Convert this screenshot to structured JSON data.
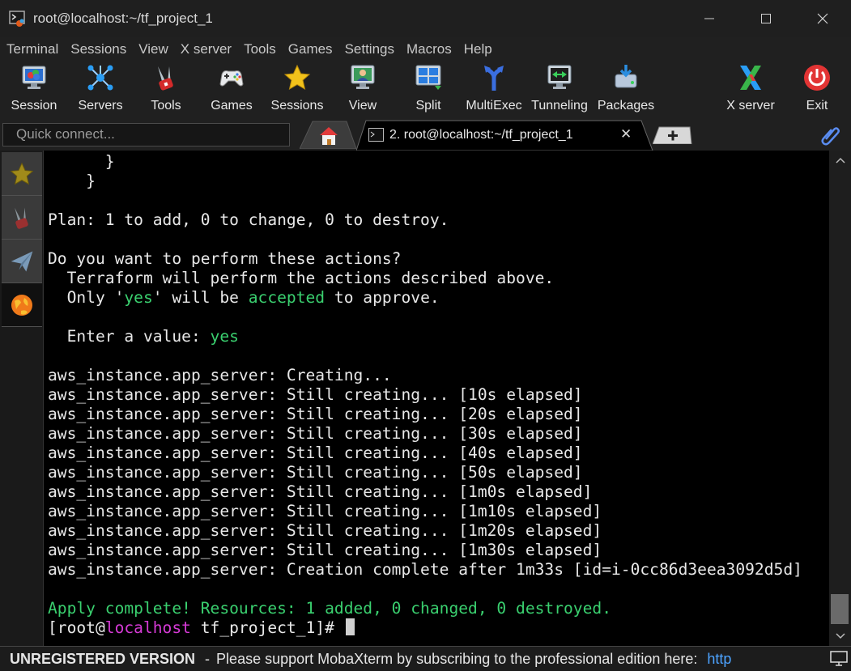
{
  "window": {
    "title": "root@localhost:~/tf_project_1",
    "minimize": "—",
    "maximize": "☐",
    "close": "✕"
  },
  "menu": [
    "Terminal",
    "Sessions",
    "View",
    "X server",
    "Tools",
    "Games",
    "Settings",
    "Macros",
    "Help"
  ],
  "toolbar": {
    "session": "Session",
    "servers": "Servers",
    "tools": "Tools",
    "games": "Games",
    "sessions": "Sessions",
    "view": "View",
    "split": "Split",
    "multiexec": "MultiExec",
    "tunneling": "Tunneling",
    "packages": "Packages",
    "xserver": "X server",
    "exit": "Exit"
  },
  "tabs": {
    "quick_connect_placeholder": "Quick connect...",
    "session_tab_label": "2. root@localhost:~/tf_project_1",
    "close_glyph": "✕"
  },
  "terminal": {
    "lines": [
      "      }",
      "    }",
      "",
      "Plan: 1 to add, 0 to change, 0 to destroy.",
      "",
      "Do you want to perform these actions?",
      "  Terraform will perform the actions described above.",
      "  Only ",
      "",
      "  Enter a value: ",
      "",
      "aws_instance.app_server: Creating...",
      "aws_instance.app_server: Still creating... [10s elapsed]",
      "aws_instance.app_server: Still creating... [20s elapsed]",
      "aws_instance.app_server: Still creating... [30s elapsed]",
      "aws_instance.app_server: Still creating... [40s elapsed]",
      "aws_instance.app_server: Still creating... [50s elapsed]",
      "aws_instance.app_server: Still creating... [1m0s elapsed]",
      "aws_instance.app_server: Still creating... [1m10s elapsed]",
      "aws_instance.app_server: Still creating... [1m20s elapsed]",
      "aws_instance.app_server: Still creating... [1m30s elapsed]",
      "aws_instance.app_server: Creation complete after 1m33s [id=i-0cc86d3eea3092d5d]",
      ""
    ],
    "only_prefix": "'",
    "only_yes": "yes",
    "only_mid": "' will be ",
    "only_accepted": "accepted",
    "only_suffix": " to approve.",
    "enter_value_answer": "yes",
    "apply_complete": "Apply complete! Resources: 1 added, 0 changed, 0 destroyed.",
    "prompt_open": "[root@",
    "prompt_host": "localhost",
    "prompt_rest": " tf_project_1]# "
  },
  "status": {
    "unregistered": "UNREGISTERED VERSION",
    "separator": "-",
    "message": "Please support MobaXterm by subscribing to the professional edition here:",
    "link": "http"
  },
  "colors": {
    "green": "#3ad06f",
    "magenta": "#d63ad6",
    "background": "#000000"
  }
}
